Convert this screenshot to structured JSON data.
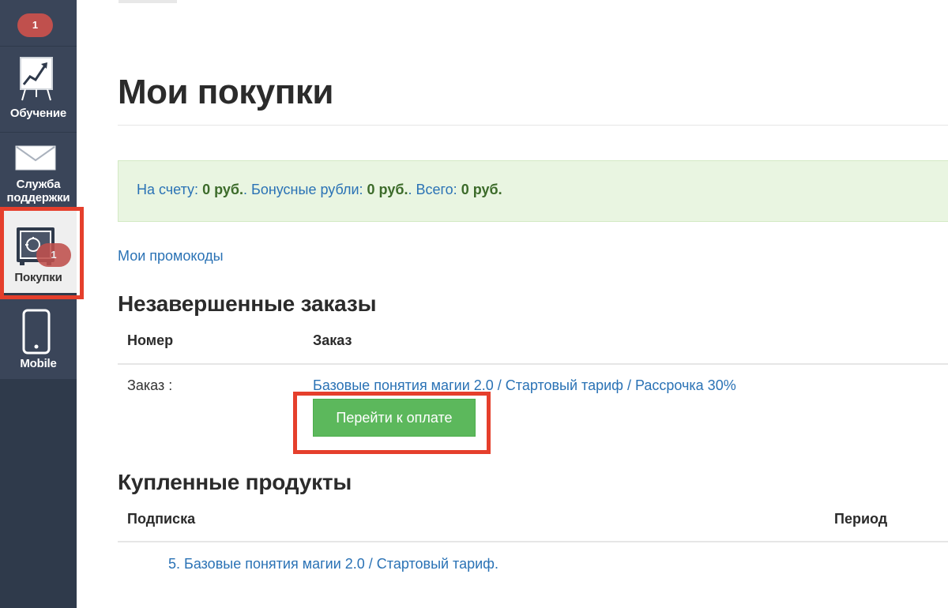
{
  "sidebar": {
    "top_badge": "1",
    "items": [
      {
        "label": "Обучение",
        "icon": "chart-easel-icon"
      },
      {
        "label": "Служба поддержки",
        "label_lines": [
          "Служба",
          "поддержки"
        ],
        "icon": "envelope-icon"
      },
      {
        "label": "Покупки",
        "icon": "safe-icon",
        "badge": "1",
        "active": true
      },
      {
        "label": "Mobile",
        "icon": "smartphone-icon"
      }
    ]
  },
  "main": {
    "title": "Мои покупки",
    "balance": {
      "account_label": "На счету:",
      "account_value": "0 руб.",
      "sep1": ".",
      "bonus_label": "Бонусные рубли:",
      "bonus_value": "0 руб.",
      "sep2": ".",
      "total_label": "Всего:",
      "total_value": "0 руб."
    },
    "promocodes_link": "Мои промокоды",
    "incomplete_orders": {
      "title": "Незавершенные заказы",
      "columns": [
        "Номер",
        "Заказ"
      ],
      "rows": [
        {
          "number": "Заказ :",
          "order": "Базовые понятия магии 2.0 / Стартовый тариф / Рассрочка 30%",
          "button": "Перейти к оплате"
        }
      ]
    },
    "purchased_products": {
      "title": "Купленные продукты",
      "columns": [
        "Подписка",
        "Период"
      ],
      "rows": [
        {
          "subscription": "5. Базовые понятия магии 2.0 / Стартовый тариф."
        }
      ]
    }
  },
  "colors": {
    "sidebar_bg": "#2f3a4b",
    "badge": "#c0504d",
    "highlight_outline": "#e53f2c",
    "link": "#2a72b5",
    "balance_bg": "#e9f5e1",
    "pay_button": "#5cb85c"
  }
}
